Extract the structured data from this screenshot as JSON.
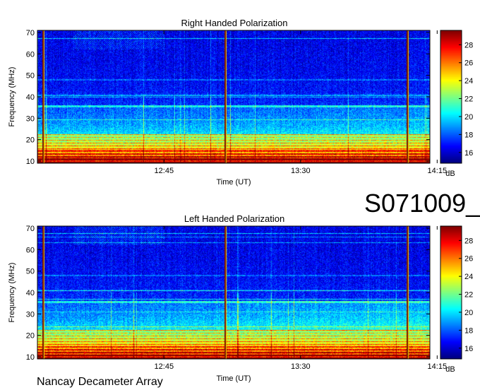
{
  "observation_id": "S071009_",
  "instrument": "Nancay Decameter Array",
  "chart_data": [
    {
      "type": "heatmap",
      "title": "Right Handed Polarization",
      "xlabel": "Time (UT)",
      "ylabel": "Frequency (MHz)",
      "x_ticks": [
        "12:45",
        "13:30",
        "14:15"
      ],
      "y_ticks": [
        10,
        20,
        30,
        40,
        50,
        60,
        70
      ],
      "ylim": [
        9,
        71
      ],
      "colorbar": {
        "label": "dB",
        "range": [
          14.8,
          29.6
        ],
        "ticks": [
          16,
          18,
          20,
          22,
          24,
          26,
          28
        ]
      },
      "vertical_lines_time": [
        "12:05",
        "13:05",
        "14:05"
      ]
    },
    {
      "type": "heatmap",
      "title": "Left Handed Polarization",
      "xlabel": "Time (UT)",
      "ylabel": "Frequency (MHz)",
      "x_ticks": [
        "12:45",
        "13:30",
        "14:15"
      ],
      "y_ticks": [
        10,
        20,
        30,
        40,
        50,
        60,
        70
      ],
      "ylim": [
        9,
        71
      ],
      "colorbar": {
        "label": "dB",
        "range": [
          14.8,
          29.6
        ],
        "ticks": [
          16,
          18,
          20,
          22,
          24,
          26,
          28
        ]
      },
      "vertical_lines_time": [
        "12:05",
        "13:05",
        "14:05"
      ]
    }
  ]
}
